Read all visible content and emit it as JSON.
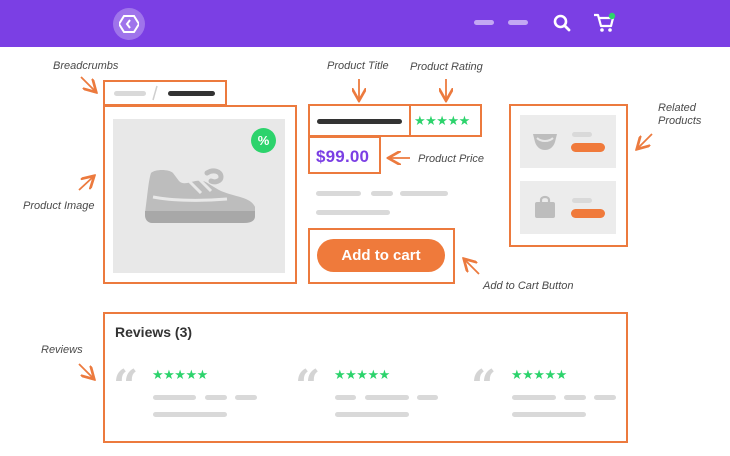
{
  "colors": {
    "brand": "#7b3fe4",
    "annotation": "#ec7a3e",
    "accent_orange": "#ef7a3b",
    "star_green": "#2cd36c",
    "placeholder": "#e8e8e8"
  },
  "header": {
    "logo_icon": "hexagon-logo-icon",
    "search_icon": "search-icon",
    "cart_icon": "cart-icon"
  },
  "annotations": {
    "breadcrumbs": "Breadcrumbs",
    "product_image": "Product Image",
    "product_title": "Product Title",
    "product_rating": "Product Rating",
    "product_price": "Product Price",
    "related_products": "Related Products",
    "add_to_cart": "Add to Cart Button",
    "reviews": "Reviews"
  },
  "product": {
    "discount_badge": "%",
    "rating_stars": "★★★★★",
    "price": "$99.00",
    "add_to_cart_label": "Add to cart",
    "image_icon": "sneaker-icon"
  },
  "related": {
    "items": [
      {
        "icon": "diaper-icon"
      },
      {
        "icon": "bag-icon"
      }
    ]
  },
  "reviews": {
    "title": "Reviews (3)",
    "items": [
      {
        "stars": "★★★★★"
      },
      {
        "stars": "★★★★★"
      },
      {
        "stars": "★★★★★"
      }
    ]
  }
}
